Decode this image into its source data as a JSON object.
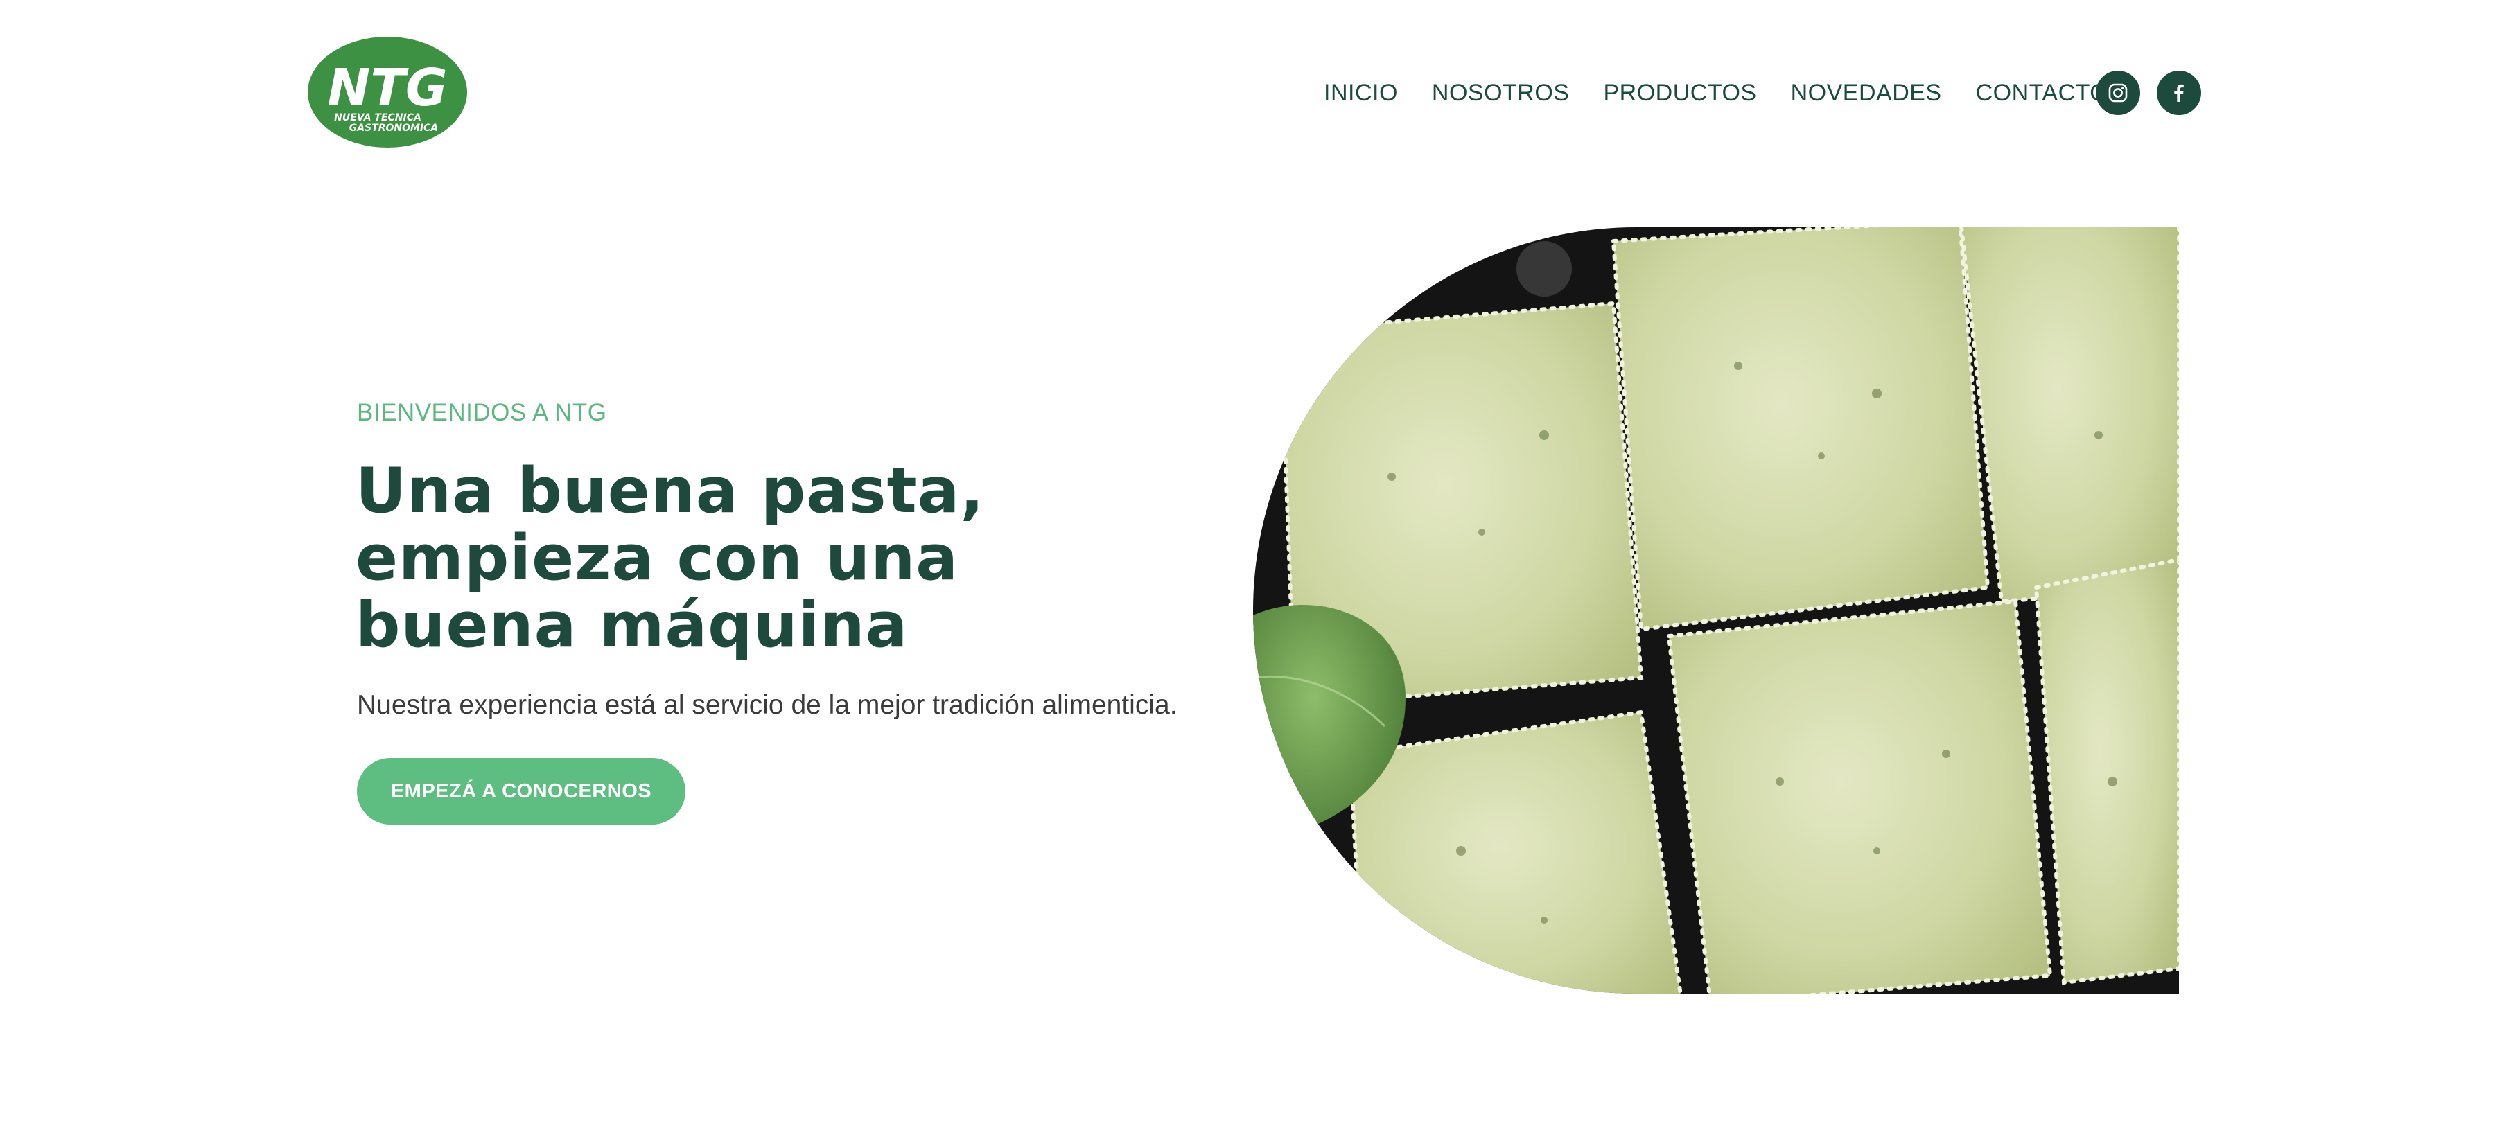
{
  "brand": {
    "logo_initials": "NTG",
    "logo_line1": "NUEVA TECNICA",
    "logo_line2": "GASTRONOMICA",
    "color": "#3d9142"
  },
  "nav": {
    "items": [
      {
        "label": "INICIO"
      },
      {
        "label": "NOSOTROS"
      },
      {
        "label": "PRODUCTOS"
      },
      {
        "label": "NOVEDADES"
      },
      {
        "label": "CONTACTO"
      }
    ]
  },
  "social": {
    "icons": [
      "instagram-icon",
      "facebook-icon"
    ]
  },
  "hero": {
    "eyebrow": "BIENVENIDOS A NTG",
    "headline_line1": "Una buena pasta,",
    "headline_line2": "empieza con una",
    "headline_line3": "buena máquina",
    "subtitle": "Nuestra experiencia está al servicio de la mejor tradición alimenticia.",
    "cta_label": "EMPEZÁ A CONOCERNOS",
    "image_subject": "green spinach ravioli on dark floured surface"
  },
  "colors": {
    "primary_dark": "#1c4a3d",
    "accent_green": "#5ebd81",
    "text_gray": "#3b3b3b"
  }
}
